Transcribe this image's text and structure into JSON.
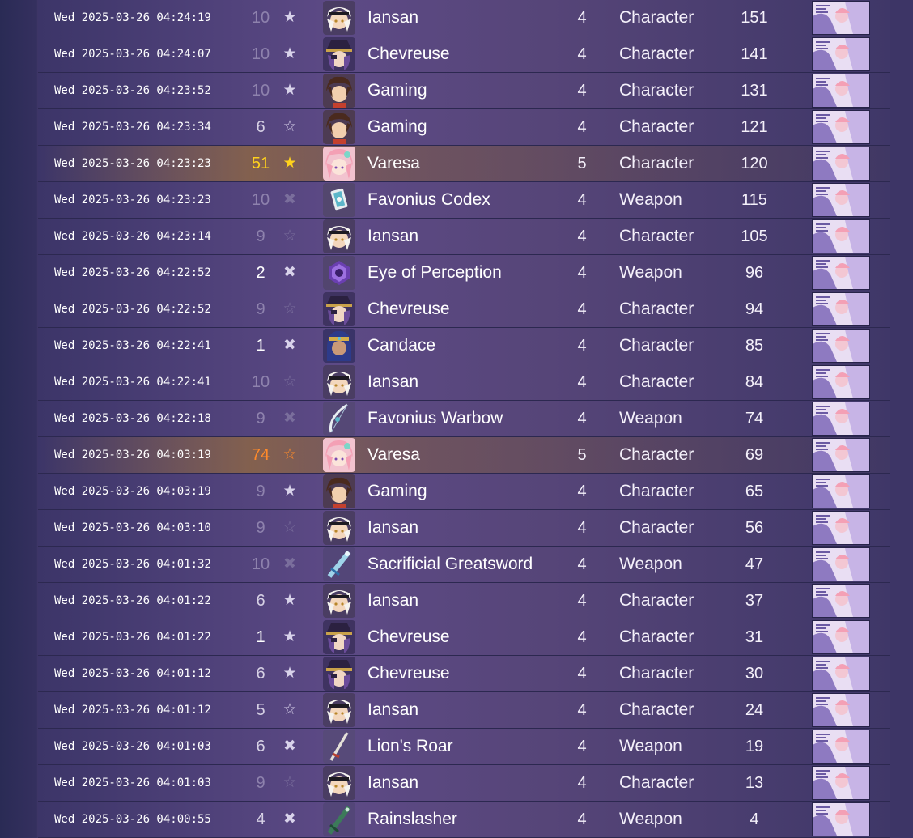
{
  "table": {
    "rows": [
      {
        "time": "Wed 2025-03-26 04:24:19",
        "pity": "10",
        "pity_tone": "lo",
        "mark": "★",
        "mark_tone": "solid",
        "icon": "iansan-portrait-icon",
        "portrait": "iansan",
        "name": "Iansan",
        "rarity": "4",
        "type": "Character",
        "pull": "151",
        "highlight": false
      },
      {
        "time": "Wed 2025-03-26 04:24:07",
        "pity": "10",
        "pity_tone": "lo",
        "mark": "★",
        "mark_tone": "solid",
        "icon": "chevreuse-portrait-icon",
        "portrait": "chevreuse",
        "name": "Chevreuse",
        "rarity": "4",
        "type": "Character",
        "pull": "141",
        "highlight": false
      },
      {
        "time": "Wed 2025-03-26 04:23:52",
        "pity": "10",
        "pity_tone": "lo",
        "mark": "★",
        "mark_tone": "solid",
        "icon": "gaming-portrait-icon",
        "portrait": "gaming",
        "name": "Gaming",
        "rarity": "4",
        "type": "Character",
        "pull": "131",
        "highlight": false
      },
      {
        "time": "Wed 2025-03-26 04:23:34",
        "pity": "6",
        "pity_tone": "mid",
        "mark": "☆",
        "mark_tone": "solid",
        "icon": "gaming-portrait-icon",
        "portrait": "gaming",
        "name": "Gaming",
        "rarity": "4",
        "type": "Character",
        "pull": "121",
        "highlight": false
      },
      {
        "time": "Wed 2025-03-26 04:23:23",
        "pity": "51",
        "pity_tone": "gold5",
        "mark": "★",
        "mark_tone": "gold",
        "icon": "varesa-portrait-icon",
        "portrait": "varesa",
        "name": "Varesa",
        "rarity": "5",
        "type": "Character",
        "pull": "120",
        "highlight": true
      },
      {
        "time": "Wed 2025-03-26 04:23:23",
        "pity": "10",
        "pity_tone": "lo",
        "mark": "✖",
        "mark_tone": "dim",
        "icon": "favonius-codex-icon",
        "portrait": "codex",
        "name": "Favonius Codex",
        "rarity": "4",
        "type": "Weapon",
        "pull": "115",
        "highlight": false
      },
      {
        "time": "Wed 2025-03-26 04:23:14",
        "pity": "9",
        "pity_tone": "lo",
        "mark": "☆",
        "mark_tone": "dim",
        "icon": "iansan-portrait-icon",
        "portrait": "iansan",
        "name": "Iansan",
        "rarity": "4",
        "type": "Character",
        "pull": "105",
        "highlight": false
      },
      {
        "time": "Wed 2025-03-26 04:22:52",
        "pity": "2",
        "pity_tone": "hi",
        "mark": "✖",
        "mark_tone": "solid",
        "icon": "eye-of-perception-icon",
        "portrait": "eye",
        "name": "Eye of Perception",
        "rarity": "4",
        "type": "Weapon",
        "pull": "96",
        "highlight": false
      },
      {
        "time": "Wed 2025-03-26 04:22:52",
        "pity": "9",
        "pity_tone": "lo",
        "mark": "☆",
        "mark_tone": "dim",
        "icon": "chevreuse-portrait-icon",
        "portrait": "chevreuse",
        "name": "Chevreuse",
        "rarity": "4",
        "type": "Character",
        "pull": "94",
        "highlight": false
      },
      {
        "time": "Wed 2025-03-26 04:22:41",
        "pity": "1",
        "pity_tone": "hi",
        "mark": "✖",
        "mark_tone": "solid",
        "icon": "candace-portrait-icon",
        "portrait": "candace",
        "name": "Candace",
        "rarity": "4",
        "type": "Character",
        "pull": "85",
        "highlight": false
      },
      {
        "time": "Wed 2025-03-26 04:22:41",
        "pity": "10",
        "pity_tone": "lo",
        "mark": "☆",
        "mark_tone": "dim",
        "icon": "iansan-portrait-icon",
        "portrait": "iansan",
        "name": "Iansan",
        "rarity": "4",
        "type": "Character",
        "pull": "84",
        "highlight": false
      },
      {
        "time": "Wed 2025-03-26 04:22:18",
        "pity": "9",
        "pity_tone": "lo",
        "mark": "✖",
        "mark_tone": "dim",
        "icon": "favonius-warbow-icon",
        "portrait": "bow",
        "name": "Favonius Warbow",
        "rarity": "4",
        "type": "Weapon",
        "pull": "74",
        "highlight": false
      },
      {
        "time": "Wed 2025-03-26 04:03:19",
        "pity": "74",
        "pity_tone": "orange",
        "mark": "☆",
        "mark_tone": "orange",
        "icon": "varesa-portrait-icon",
        "portrait": "varesa",
        "name": "Varesa",
        "rarity": "5",
        "type": "Character",
        "pull": "69",
        "highlight": true
      },
      {
        "time": "Wed 2025-03-26 04:03:19",
        "pity": "9",
        "pity_tone": "lo",
        "mark": "★",
        "mark_tone": "solid",
        "icon": "gaming-portrait-icon",
        "portrait": "gaming",
        "name": "Gaming",
        "rarity": "4",
        "type": "Character",
        "pull": "65",
        "highlight": false
      },
      {
        "time": "Wed 2025-03-26 04:03:10",
        "pity": "9",
        "pity_tone": "lo",
        "mark": "☆",
        "mark_tone": "dim",
        "icon": "iansan-portrait-icon",
        "portrait": "iansan",
        "name": "Iansan",
        "rarity": "4",
        "type": "Character",
        "pull": "56",
        "highlight": false
      },
      {
        "time": "Wed 2025-03-26 04:01:32",
        "pity": "10",
        "pity_tone": "lo",
        "mark": "✖",
        "mark_tone": "dim",
        "icon": "sacrificial-greatsword-icon",
        "portrait": "greatsword",
        "name": "Sacrificial Greatsword",
        "rarity": "4",
        "type": "Weapon",
        "pull": "47",
        "highlight": false
      },
      {
        "time": "Wed 2025-03-26 04:01:22",
        "pity": "6",
        "pity_tone": "mid",
        "mark": "★",
        "mark_tone": "solid",
        "icon": "iansan-portrait-icon",
        "portrait": "iansan",
        "name": "Iansan",
        "rarity": "4",
        "type": "Character",
        "pull": "37",
        "highlight": false
      },
      {
        "time": "Wed 2025-03-26 04:01:22",
        "pity": "1",
        "pity_tone": "hi",
        "mark": "★",
        "mark_tone": "solid",
        "icon": "chevreuse-portrait-icon",
        "portrait": "chevreuse",
        "name": "Chevreuse",
        "rarity": "4",
        "type": "Character",
        "pull": "31",
        "highlight": false
      },
      {
        "time": "Wed 2025-03-26 04:01:12",
        "pity": "6",
        "pity_tone": "mid",
        "mark": "★",
        "mark_tone": "solid",
        "icon": "chevreuse-portrait-icon",
        "portrait": "chevreuse",
        "name": "Chevreuse",
        "rarity": "4",
        "type": "Character",
        "pull": "30",
        "highlight": false
      },
      {
        "time": "Wed 2025-03-26 04:01:12",
        "pity": "5",
        "pity_tone": "mid",
        "mark": "☆",
        "mark_tone": "solid",
        "icon": "iansan-portrait-icon",
        "portrait": "iansan",
        "name": "Iansan",
        "rarity": "4",
        "type": "Character",
        "pull": "24",
        "highlight": false
      },
      {
        "time": "Wed 2025-03-26 04:01:03",
        "pity": "6",
        "pity_tone": "mid",
        "mark": "✖",
        "mark_tone": "solid",
        "icon": "lions-roar-icon",
        "portrait": "sword",
        "name": "Lion's Roar",
        "rarity": "4",
        "type": "Weapon",
        "pull": "19",
        "highlight": false
      },
      {
        "time": "Wed 2025-03-26 04:01:03",
        "pity": "9",
        "pity_tone": "lo",
        "mark": "☆",
        "mark_tone": "dim",
        "icon": "iansan-portrait-icon",
        "portrait": "iansan",
        "name": "Iansan",
        "rarity": "4",
        "type": "Character",
        "pull": "13",
        "highlight": false
      },
      {
        "time": "Wed 2025-03-26 04:00:55",
        "pity": "4",
        "pity_tone": "mid",
        "mark": "✖",
        "mark_tone": "solid",
        "icon": "rainslasher-icon",
        "portrait": "claymore",
        "name": "Rainslasher",
        "rarity": "4",
        "type": "Weapon",
        "pull": "4",
        "highlight": false
      }
    ]
  },
  "colors": {
    "background": "#2a2b55",
    "row_purple": "#5d4a86",
    "gold_accent": "#ffd21c",
    "orange_accent": "#ff8a2a"
  },
  "icons": {
    "banner": "banner-thumbnail-icon"
  }
}
